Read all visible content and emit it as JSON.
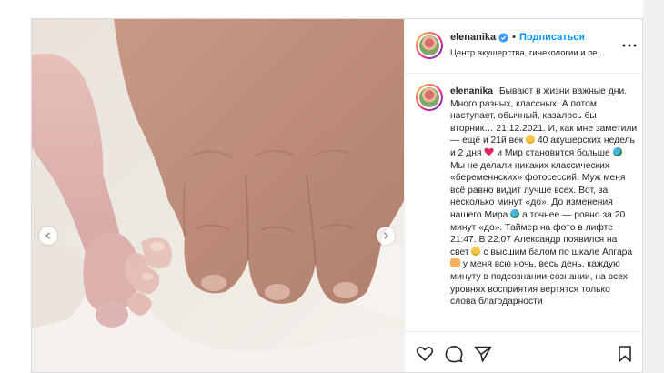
{
  "post": {
    "username": "elenanika",
    "follow_label": "Подписаться",
    "separator": "•",
    "location": "Центр акушерства, гинекологии и пе...",
    "caption": {
      "username": "elenanika",
      "segments": [
        "Бывают в жизни важные дни. Много разных, классных. А потом наступает, обычный, казалось бы вторник… 21.12.2021. И, как мне заметили — ещё и 21й век ",
        " 40 акушерских недель и 2 дня ",
        " и Мир становится больше ",
        " Мы не делали никаких классических «беременнских» фотосессий. Муж меня всё равно видит лучше всех. Вот, за несколько минут «до». До изменения нашего Мира ",
        " а точнее — ровно за 20 минут «до». Таймер на фото в лифте 21:47. В 22:07 Александр появился на свет ",
        " с высшим балом по шкале Апгара ",
        " у меня всю ночь, весь день, каждую минуту в подсознании-сознании, на всех уровнях восприятия вертятся только слова благодарности"
      ],
      "emojis": [
        "scream-emoji",
        "red-heart-emoji",
        "globe-emoji",
        "globe-emoji",
        "smiling-face-emoji",
        "folded-hands-emoji"
      ]
    }
  },
  "icons": {
    "verified": "verified-badge-icon",
    "more": "more-options-icon",
    "prev": "chevron-left-icon",
    "next": "chevron-right-icon",
    "like": "heart-icon",
    "comment": "comment-icon",
    "share": "paper-plane-icon",
    "save": "bookmark-icon"
  },
  "colors": {
    "accent": "#0095f6",
    "text": "#262626",
    "border": "#dbdbdb"
  }
}
